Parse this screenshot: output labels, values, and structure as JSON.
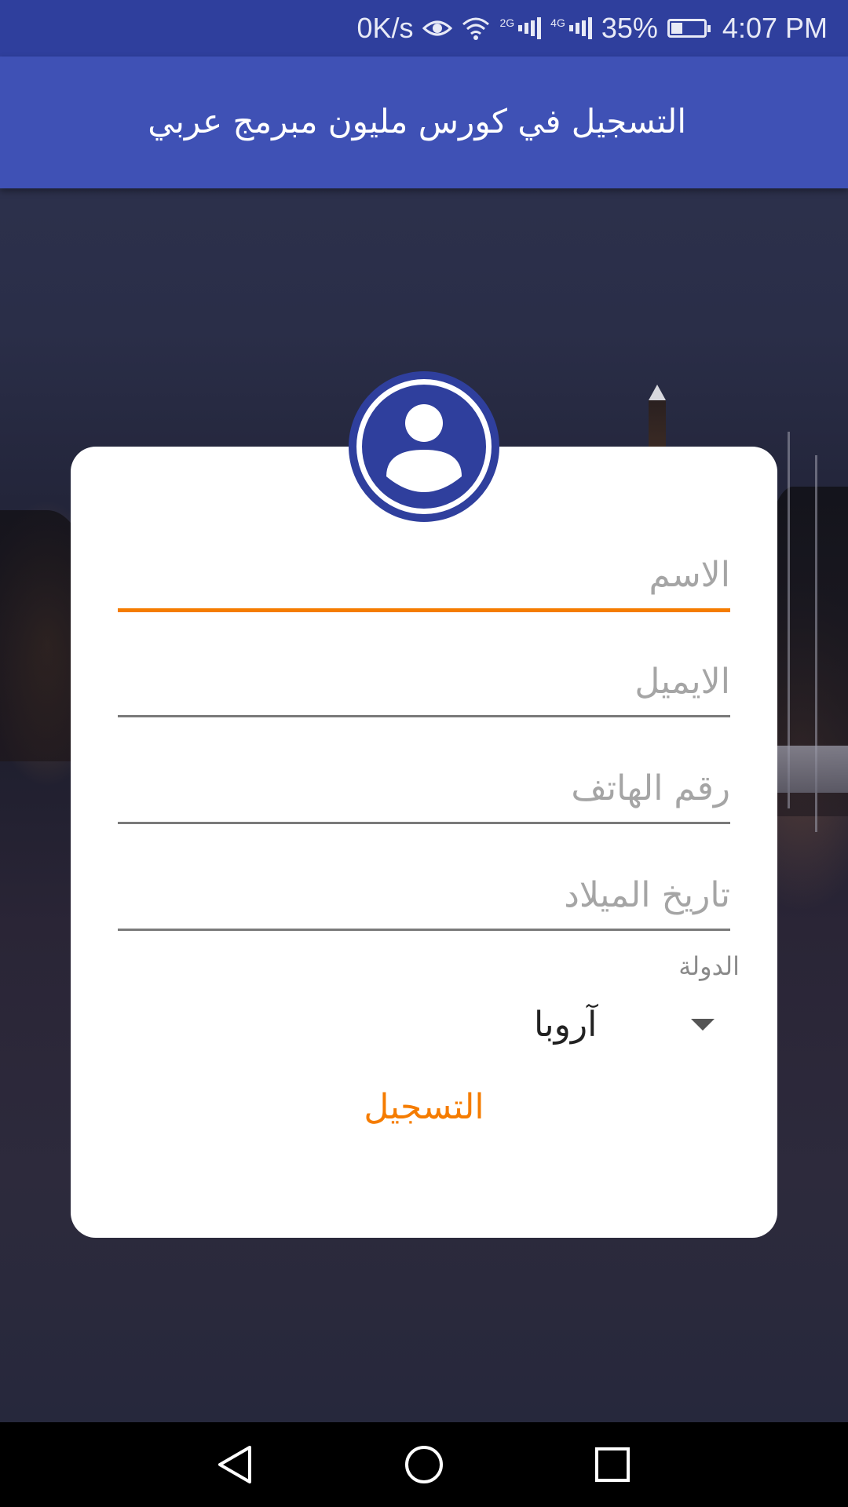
{
  "status_bar": {
    "speed": "0K/s",
    "network_1": "2G",
    "network_2": "4G",
    "battery_percent": "35%",
    "battery_level": 0.35,
    "time": "4:07 PM"
  },
  "app_bar": {
    "title": "التسجيل في كورس مليون مبرمج عربي"
  },
  "form": {
    "name_placeholder": "الاسم",
    "email_placeholder": "الايميل",
    "phone_placeholder": "رقم الهاتف",
    "birthdate_placeholder": "تاريخ الميلاد",
    "country_label": "الدولة",
    "country_value": "آروبا",
    "register_label": "التسجيل"
  },
  "colors": {
    "primary": "#3f51b5",
    "primary_dark": "#2f3f9d",
    "accent": "#f57c00"
  },
  "nav_bar": {
    "back_icon": "back-triangle-icon",
    "home_icon": "home-circle-icon",
    "recents_icon": "recents-square-icon"
  }
}
